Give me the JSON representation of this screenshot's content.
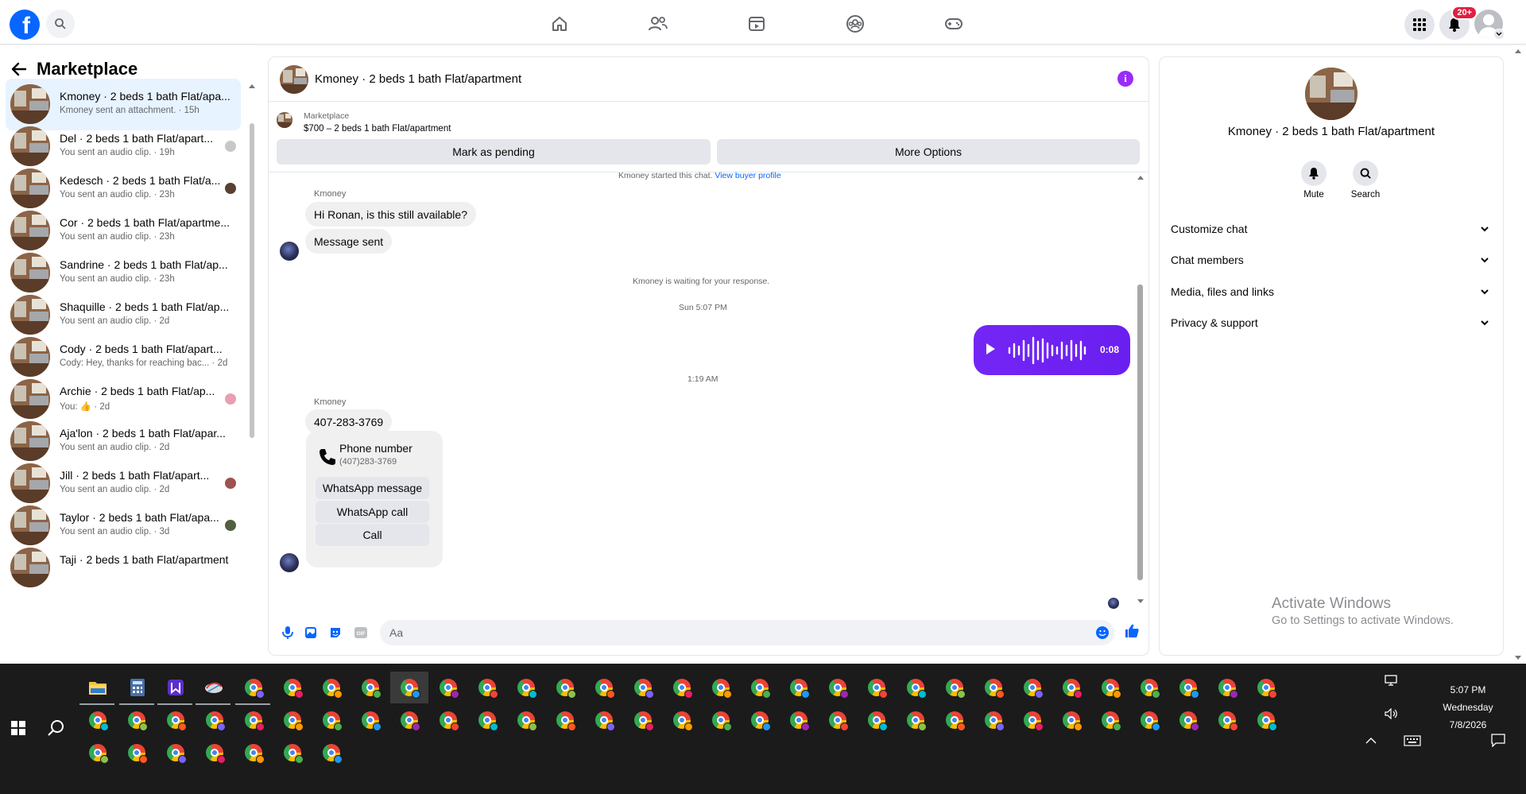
{
  "topnav": {
    "logo": "f",
    "notifications_badge": "20+",
    "tabs": [
      "home-icon",
      "friends-icon",
      "watch-icon",
      "groups-icon",
      "gaming-icon"
    ]
  },
  "sidebar": {
    "title": "Marketplace",
    "conversations": [
      {
        "title": "Kmoney · 2 beds 1 bath Flat/apa...",
        "sub": "Kmoney sent an attachment. · 15h",
        "active": true,
        "mini": ""
      },
      {
        "title": "Del · 2 beds 1 bath Flat/apart...",
        "sub": "You sent an audio clip. · 19h",
        "mini": "#c8c8c8"
      },
      {
        "title": "Kedesch · 2 beds 1 bath Flat/a...",
        "sub": "You sent an audio clip. · 23h",
        "mini": "#5a4030"
      },
      {
        "title": "Cor · 2 beds 1 bath Flat/apartme...",
        "sub": "You sent an audio clip. · 23h",
        "mini": ""
      },
      {
        "title": "Sandrine · 2 beds 1 bath Flat/ap...",
        "sub": "You sent an audio clip. · 23h",
        "mini": ""
      },
      {
        "title": "Shaquille · 2 beds 1 bath Flat/ap...",
        "sub": "You sent an audio clip. · 2d",
        "mini": ""
      },
      {
        "title": "Cody · 2 beds 1 bath Flat/apart...",
        "sub": "Cody: Hey, thanks for reaching bac... · 2d",
        "mini": ""
      },
      {
        "title": "Archie · 2 beds 1 bath Flat/ap...",
        "sub": "You: 👍 · 2d",
        "mini": "#e8a0b0"
      },
      {
        "title": "Aja'lon · 2 beds 1 bath Flat/apar...",
        "sub": "You sent an audio clip. · 2d",
        "mini": ""
      },
      {
        "title": "Jill · 2 beds 1 bath Flat/apart...",
        "sub": "You sent an audio clip. · 2d",
        "mini": "#a05050"
      },
      {
        "title": "Taylor · 2 beds 1 bath Flat/apa...",
        "sub": "You sent an audio clip. · 3d",
        "mini": "#506040"
      },
      {
        "title": "Taji · 2 beds 1 bath Flat/apartment",
        "sub": "",
        "mini": ""
      }
    ]
  },
  "chat": {
    "header_name": "Kmoney · 2 beds 1 bath Flat/apartment",
    "listing_source": "Marketplace",
    "listing_price": "$700 – 2 beds 1 bath Flat/apartment",
    "mark_pending": "Mark as pending",
    "more_options": "More Options",
    "started_text": "Kmoney started this chat. ",
    "view_buyer": "View buyer profile",
    "sender1": "Kmoney",
    "msg1": "Hi Ronan, is this still available?",
    "msg2": "Message sent",
    "waiting": "Kmoney is waiting for your response.",
    "time1": "Sun 5:07 PM",
    "audio_duration": "0:08",
    "time2": "1:19 AM",
    "sender2": "Kmoney",
    "msg3": "407-283-3769",
    "phone_title": "Phone number",
    "phone_number": "(407)283-3769",
    "whatsapp_message": "WhatsApp message",
    "whatsapp_call": "WhatsApp call",
    "call": "Call",
    "composer_placeholder": "Aa"
  },
  "info_panel": {
    "name": "Kmoney · 2 beds 1 bath Flat/apartment",
    "mute": "Mute",
    "search": "Search",
    "rows": [
      "Customize chat",
      "Chat members",
      "Media, files and links",
      "Privacy & support"
    ]
  },
  "watermark": {
    "line1": "Activate Windows",
    "line2": "Go to Settings to activate Windows."
  },
  "taskbar": {
    "time": "5:07 PM",
    "day": "Wednesday",
    "date": "7/8/2026"
  }
}
